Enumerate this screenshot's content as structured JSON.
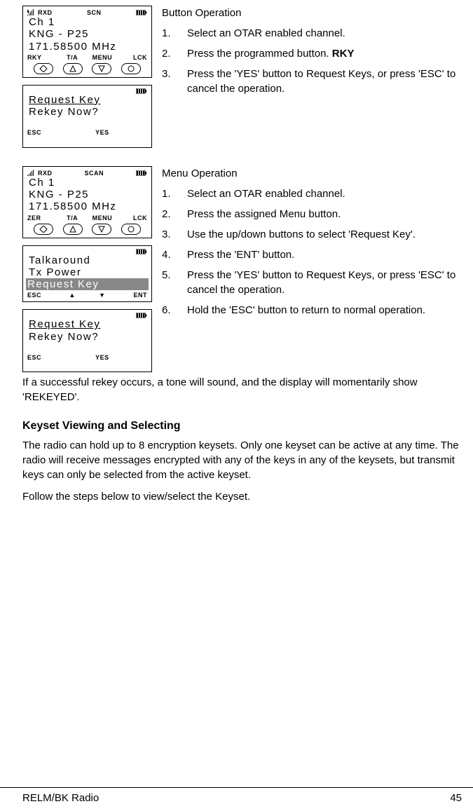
{
  "section1": {
    "title": "Button Operation",
    "steps": [
      {
        "n": "1.",
        "t": "Select an OTAR enabled channel."
      },
      {
        "n": "2.",
        "t": "Press the programmed button. ",
        "bold": "RKY"
      },
      {
        "n": "3.",
        "t": "Press the 'YES' button to Request Keys, or press 'ESC' to cancel the operation."
      }
    ],
    "lcd1": {
      "status_rxd": "RXD",
      "status_scn": "SCN",
      "l1": "Ch 1",
      "l2": "KNG - P25",
      "l3": "171.58500 MHz",
      "sk": [
        "RKY",
        "T/A",
        "MENU",
        "LCK"
      ]
    },
    "lcd2": {
      "l1": "Request Key",
      "l2": "Rekey Now?",
      "sk": [
        "ESC",
        "",
        "YES",
        ""
      ]
    }
  },
  "section2": {
    "title": "Menu Operation",
    "steps": [
      {
        "n": "1.",
        "t": "Select an OTAR enabled channel."
      },
      {
        "n": "2.",
        "t": "Press the assigned Menu button."
      },
      {
        "n": "3.",
        "t": "Use the up/down buttons to select 'Request Key'."
      },
      {
        "n": "4.",
        "t": "Press the 'ENT' button."
      },
      {
        "n": "5.",
        "t": "Press the 'YES' button to Request Keys, or press 'ESC' to cancel the operation."
      },
      {
        "n": "6.",
        "t": "Hold the 'ESC' button to return to normal operation."
      }
    ],
    "lcd1": {
      "status_rxd": "RXD",
      "status_scn": "SCAN",
      "l1": "Ch 1",
      "l2": "KNG - P25",
      "l3": "171.58500 MHz",
      "sk": [
        "ZER",
        "T/A",
        "MENU",
        "LCK"
      ]
    },
    "lcd_menu": {
      "l1": "Talkaround",
      "l2": "Tx Power",
      "l3": "Request Key",
      "sk": [
        "ESC",
        "▲",
        "▼",
        "ENT"
      ]
    },
    "lcd3": {
      "l1": "Request Key",
      "l2": "Rekey Now?",
      "sk": [
        "ESC",
        "",
        "YES",
        ""
      ]
    },
    "after": "If a successful rekey occurs, a tone will sound, and the display will momentarily show 'REKEYED'."
  },
  "section3": {
    "heading": "Keyset Viewing and Selecting",
    "p1": "The radio can hold up to 8 encryption keysets.  Only one keyset can be active at any time.  The radio will receive messages encrypted with any of the keys in any of the keysets, but transmit keys can only be selected from the active keyset.",
    "p2": "Follow the steps below to view/select the Keyset."
  },
  "footer": {
    "left": "RELM/BK Radio",
    "right": "45"
  }
}
